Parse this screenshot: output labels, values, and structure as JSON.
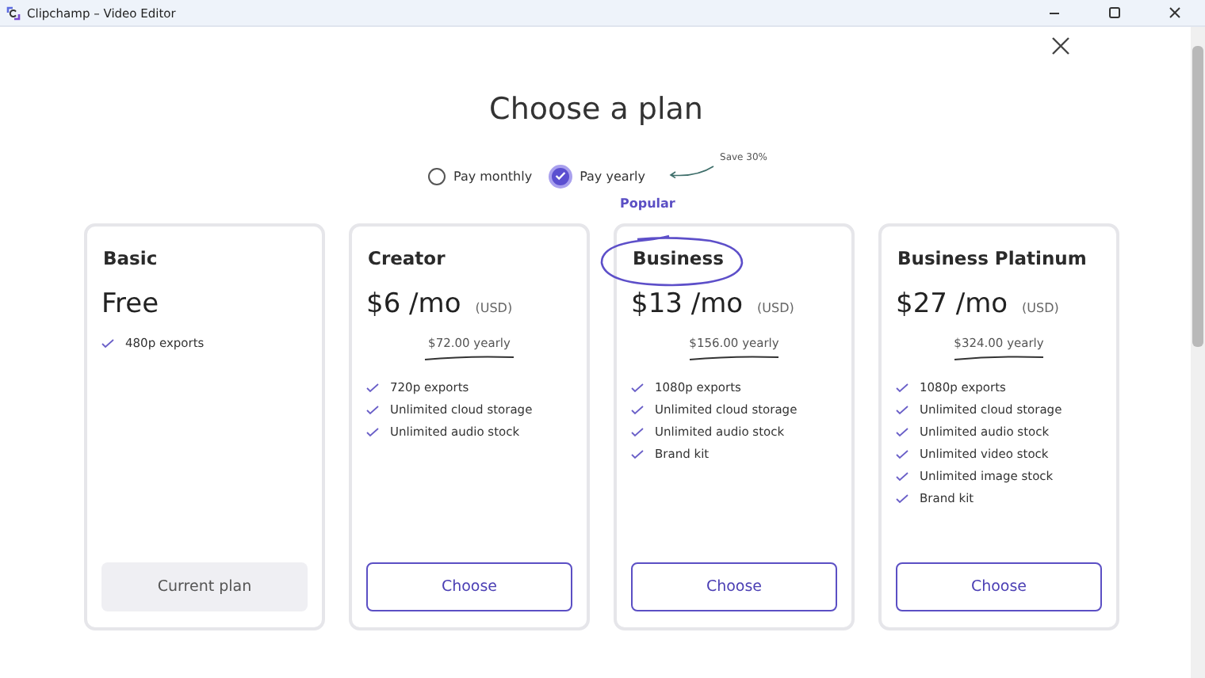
{
  "window": {
    "title": "Clipchamp – Video Editor"
  },
  "heading": "Choose a plan",
  "billing": {
    "options": [
      {
        "label": "Pay monthly",
        "selected": false
      },
      {
        "label": "Pay yearly",
        "selected": true
      }
    ],
    "note": "Save 30%"
  },
  "plans": [
    {
      "name": "Basic",
      "price": "Free",
      "features": [
        "480p exports"
      ],
      "button": {
        "label": "Current plan",
        "kind": "current"
      }
    },
    {
      "name": "Creator",
      "price": "$6 /mo",
      "currency": "(USD)",
      "yearly": "$72.00 yearly",
      "features": [
        "720p exports",
        "Unlimited cloud storage",
        "Unlimited audio stock"
      ],
      "button": {
        "label": "Choose",
        "kind": "choose"
      }
    },
    {
      "name": "Business",
      "badge": "Popular",
      "circled": true,
      "price": "$13 /mo",
      "currency": "(USD)",
      "yearly": "$156.00 yearly",
      "features": [
        "1080p exports",
        "Unlimited cloud storage",
        "Unlimited audio stock",
        "Brand kit"
      ],
      "button": {
        "label": "Choose",
        "kind": "choose"
      }
    },
    {
      "name": "Business Platinum",
      "price": "$27 /mo",
      "currency": "(USD)",
      "yearly": "$324.00 yearly",
      "features": [
        "1080p exports",
        "Unlimited cloud storage",
        "Unlimited audio stock",
        "Unlimited video stock",
        "Unlimited image stock",
        "Brand kit"
      ],
      "button": {
        "label": "Choose",
        "kind": "choose"
      }
    }
  ]
}
